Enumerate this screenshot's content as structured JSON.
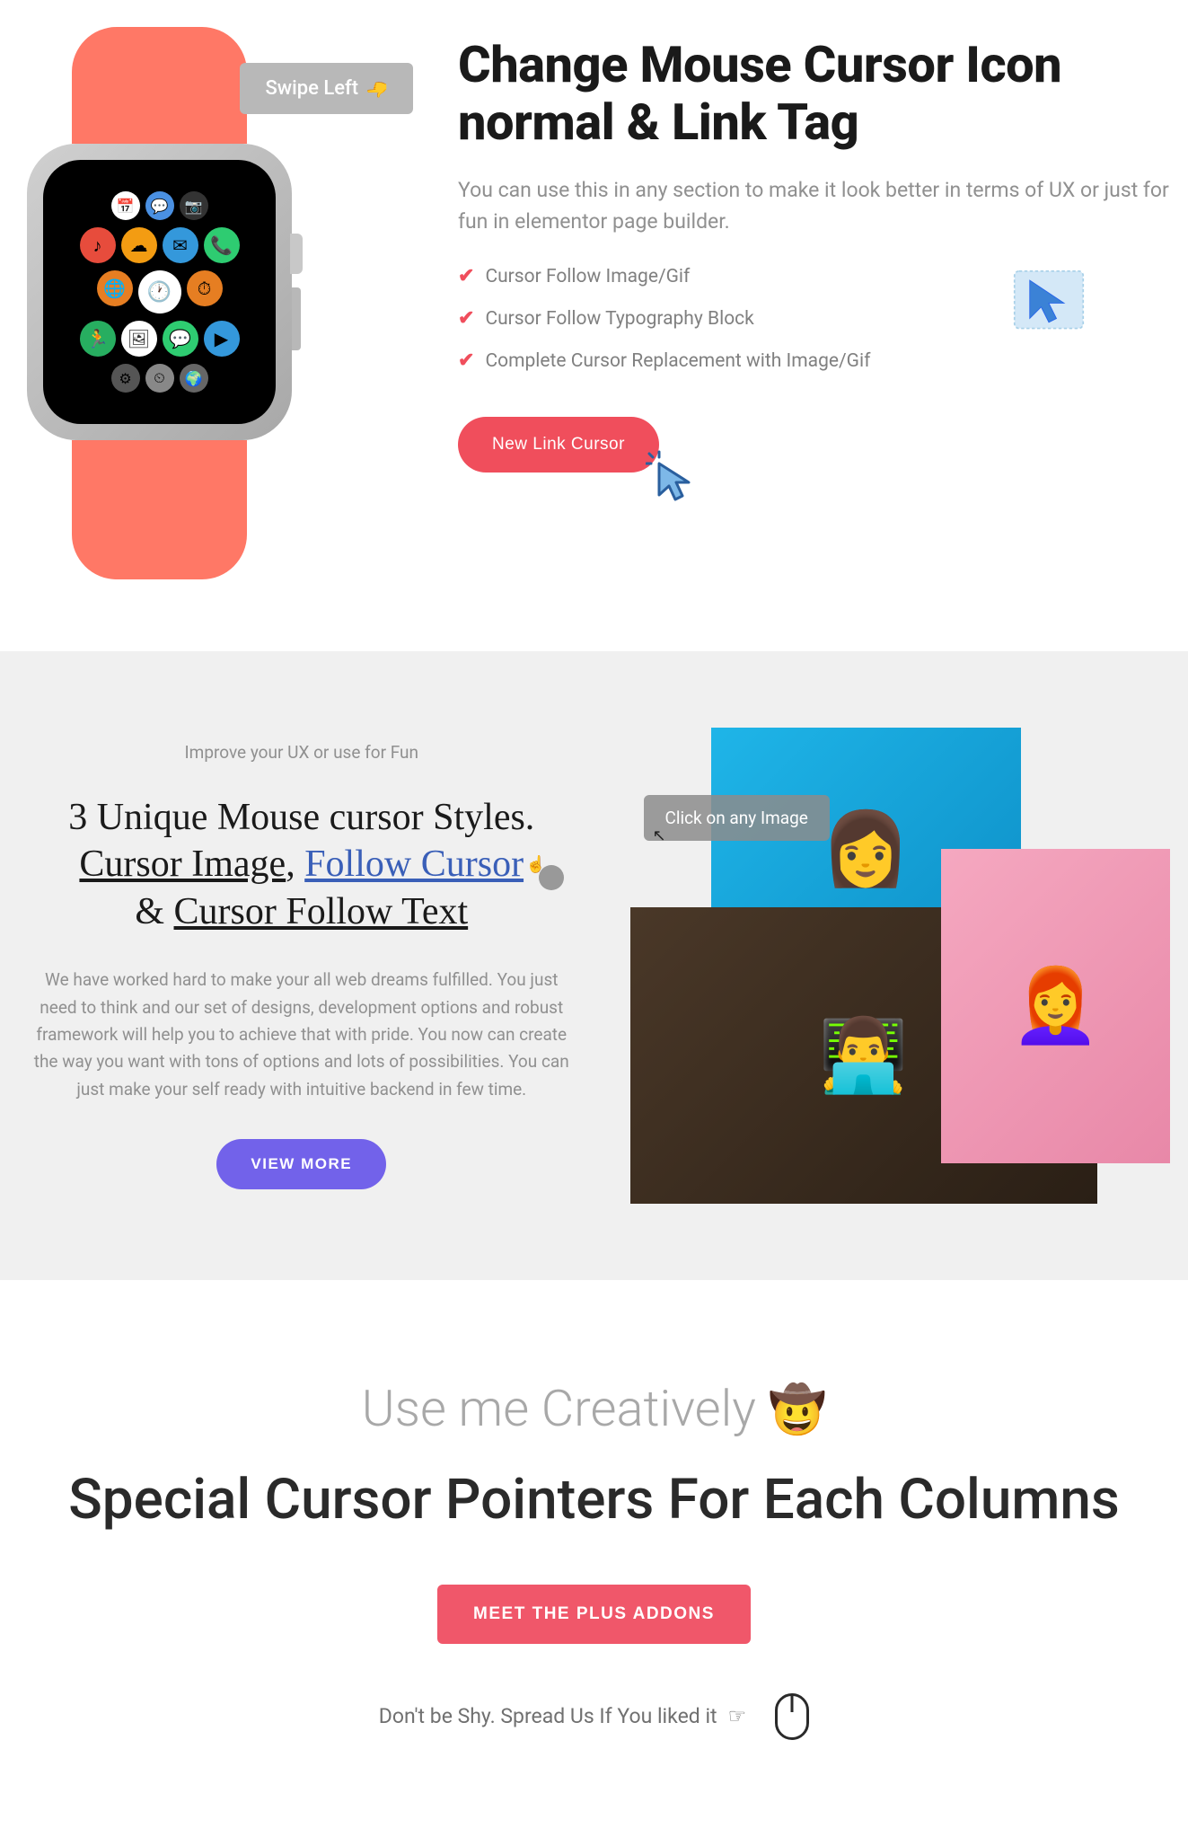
{
  "section1": {
    "swipe_badge": "Swipe Left",
    "title": "Change Mouse Cursor Icon normal & Link Tag",
    "subtitle": "You can use this in any section to make it look better in terms of UX or just for fun in elementor page builder.",
    "features": [
      "Cursor Follow Image/Gif",
      "Cursor Follow Typography Block",
      "Complete Cursor Replacement with Image/Gif"
    ],
    "button": "New Link Cursor"
  },
  "section2": {
    "improve": "Improve your UX or use for Fun",
    "title_line1": "3 Unique Mouse cursor Styles.",
    "title_u1": "Cursor Image",
    "title_sep1": ", ",
    "title_link": "Follow Cursor",
    "title_sep2": " & ",
    "title_u2": "Cursor Follow Text",
    "paragraph": "We have worked hard to make your all web dreams fulfilled. You just need to think and our set of designs, development options and robust framework will help you to achieve that with pride. You now can create the way you want with tons of options and lots of possibilities. You can just make your self ready with intuitive backend in few time.",
    "button": "VIEW MORE",
    "image_badge": "Click on any Image"
  },
  "section3": {
    "subtitle_text": "Use me Creatively ",
    "subtitle_emoji": "🤠",
    "title": "Special Cursor Pointers For Each Columns",
    "button": "MEET THE PLUS ADDONS",
    "spread": "Don't be Shy. Spread Us If You liked it"
  }
}
